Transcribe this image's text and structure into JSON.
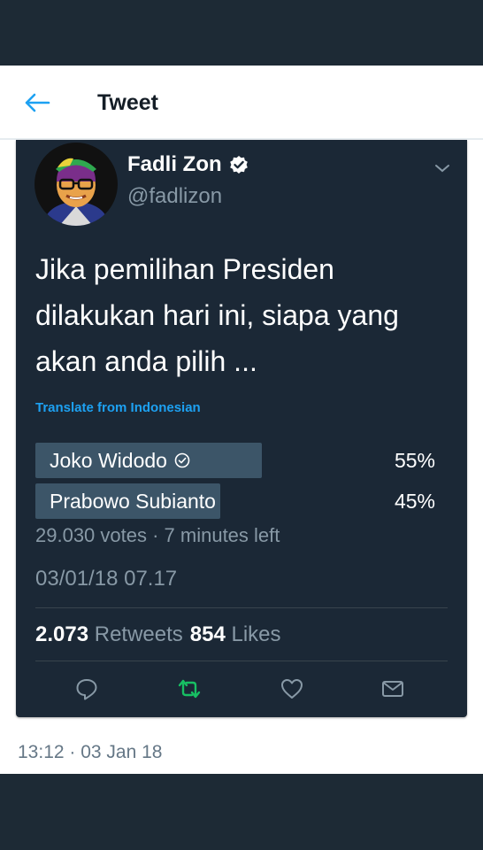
{
  "appbar": {
    "title": "Tweet"
  },
  "tweet": {
    "author_name": "Fadli Zon",
    "author_handle": "@fadlizon",
    "text_lines": [
      "Jika pemilihan Presiden",
      "dilakukan hari ini, siapa yang",
      "akan anda pilih ..."
    ],
    "translate_label": "Translate from Indonesian",
    "poll": {
      "options": [
        {
          "label": "Joko Widodo",
          "percent_label": "55%",
          "percent": 55,
          "verified": true
        },
        {
          "label": "Prabowo Subianto",
          "percent_label": "45%",
          "percent": 45,
          "verified": false
        }
      ],
      "meta": "29.030 votes · 7 minutes left"
    },
    "timestamp": "03/01/18 07.17",
    "stats": {
      "retweets_count": "2.073",
      "retweets_label": "Retweets",
      "likes_count": "854",
      "likes_label": "Likes"
    }
  },
  "footer": {
    "time": "13:12 · 03 Jan 18"
  },
  "colors": {
    "accent": "#1da1f2",
    "retweet": "#17bf63",
    "card_bg": "#1b2836",
    "muted": "#8899a6"
  },
  "icons": [
    "back-arrow-icon",
    "verified-badge-icon",
    "caret-down-icon",
    "reply-icon",
    "retweet-icon",
    "like-icon",
    "message-icon"
  ]
}
